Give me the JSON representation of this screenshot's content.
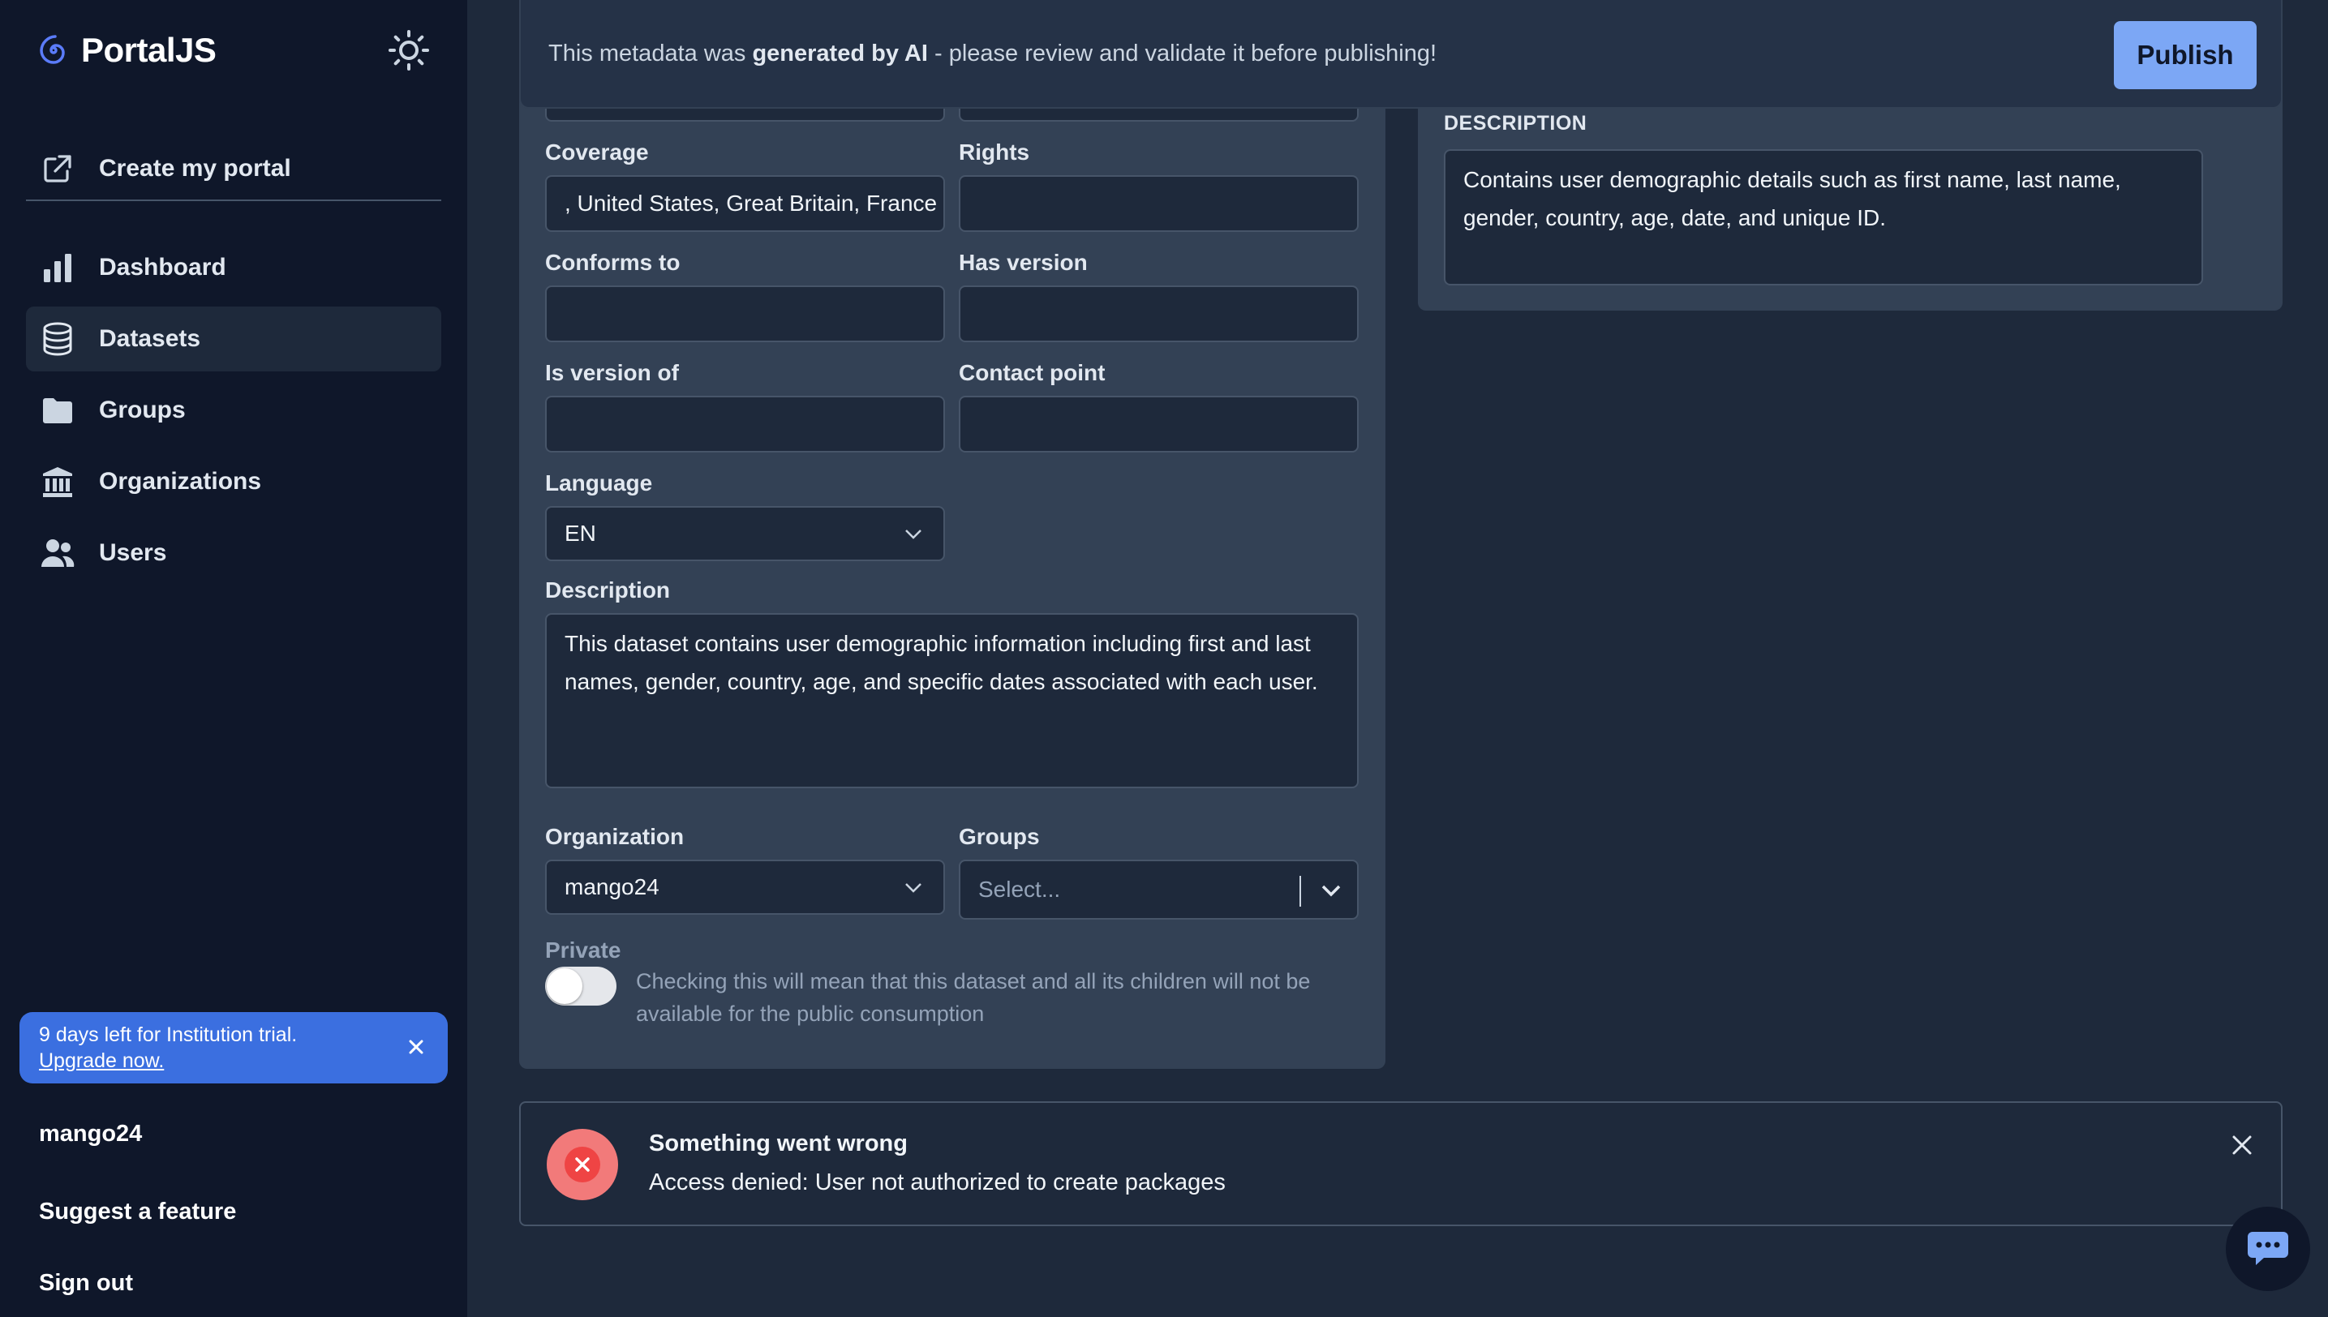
{
  "brand": {
    "name": "PortalJS"
  },
  "sidebar": {
    "create_portal": "Create my portal",
    "items": [
      {
        "label": "Dashboard",
        "icon": "bar-chart-icon"
      },
      {
        "label": "Datasets",
        "icon": "database-icon",
        "active": true
      },
      {
        "label": "Groups",
        "icon": "folder-icon"
      },
      {
        "label": "Organizations",
        "icon": "building-icon"
      },
      {
        "label": "Users",
        "icon": "users-icon"
      }
    ],
    "trial": {
      "text": "9 days left for Institution trial.",
      "link": "Upgrade now."
    },
    "username": "mango24",
    "suggest": "Suggest a feature",
    "signout": "Sign out"
  },
  "banner": {
    "prefix": "This metadata was ",
    "bold": "generated by AI",
    "suffix": " - please review and validate it before publishing!",
    "publish": "Publish"
  },
  "form": {
    "coverage": {
      "label": "Coverage",
      "value": ", United States, Great Britain, France"
    },
    "rights": {
      "label": "Rights",
      "value": ""
    },
    "conforms_to": {
      "label": "Conforms to",
      "value": ""
    },
    "has_version": {
      "label": "Has version",
      "value": ""
    },
    "is_version_of": {
      "label": "Is version of",
      "value": ""
    },
    "contact_point": {
      "label": "Contact point",
      "value": ""
    },
    "language": {
      "label": "Language",
      "value": "EN"
    },
    "description": {
      "label": "Description",
      "value": "This dataset contains user demographic information including first and last names, gender, country, age, and specific dates associated with each user."
    },
    "organization": {
      "label": "Organization",
      "value": "mango24"
    },
    "groups": {
      "label": "Groups",
      "placeholder": "Select..."
    },
    "private": {
      "label": "Private",
      "help": "Checking this will mean that this dataset and all its children will not be available for the public consumption"
    }
  },
  "resource": {
    "description_label": "DESCRIPTION",
    "description_value": "Contains user demographic details such as first name, last name, gender, country, age, date, and unique ID."
  },
  "alert": {
    "title": "Something went wrong",
    "message": "Access denied: User not authorized to create packages"
  },
  "colors": {
    "accent": "#7ca7f5",
    "trial": "#3b6fe0",
    "error": "#ef4444",
    "sidebar_bg": "#0f172a",
    "main_bg": "#1e293b",
    "panel_bg": "#334155"
  }
}
